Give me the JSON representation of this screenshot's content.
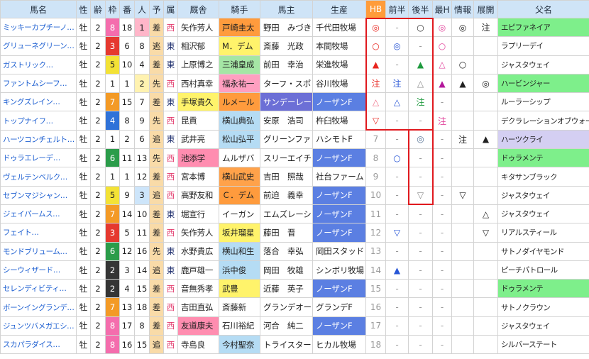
{
  "header": {
    "horse": "馬名",
    "sex": "性",
    "age": "齢",
    "waku": "枠",
    "number": "番",
    "popularity": "人",
    "style": "予",
    "affiliation": "属",
    "trainer": "厩舎",
    "jockey": "騎手",
    "owner": "馬主",
    "breeder": "生産",
    "hb": "HB",
    "first_half": "前半",
    "second_half": "後半",
    "max_h": "最H",
    "info": "情報",
    "pace": "展開",
    "sire": "父名"
  },
  "colors": {
    "header_bg": "#cfe4f7",
    "hb_header_bg": "#ff9c3a",
    "hb_header_text": "#ffffff",
    "horse_link": "#1d5fd1",
    "highlight_box": "#e0191e",
    "style_bg": "#f9dba8",
    "waku_bg": {
      "1": "#ffffff",
      "2": "#353535",
      "3": "#e5392f",
      "4": "#2f72d8",
      "5": "#f3e236",
      "6": "#2b9c4a",
      "7": "#f39a26",
      "8": "#f46dad"
    },
    "waku_text": {
      "1": "#222222",
      "2": "#ffffff",
      "3": "#ffffff",
      "4": "#ffffff",
      "5": "#222222",
      "6": "#ffffff",
      "7": "#ffffff",
      "8": "#ffffff"
    },
    "popularity_bg": {
      "1": "#ffb6c9",
      "2": "#fff2b0",
      "3": "#cde5fa"
    },
    "affiliation_text": {
      "西": "#e23a6c",
      "東": "#1f2f6e"
    },
    "mark_text": {
      "hb": "#e8261f",
      "first_half": "#2856d6",
      "second_half": "#8a8a8a",
      "max_h": "#e2459c",
      "info": "#222222",
      "pace": "#222222"
    },
    "rank_text": "#9a9a9a",
    "dash_text": "#9a9a9a"
  },
  "rows": [
    {
      "horse": "ミッキーカプチーノ…",
      "sex": "牡",
      "age": "2",
      "waku": "8",
      "number": "18",
      "popularity": "1",
      "style": "差",
      "affiliation": "西",
      "trainer": "矢作芳人",
      "jockey": "戸崎圭太",
      "owner": "野田　みづき",
      "breeder": "千代田牧場",
      "hb": "◎",
      "first_half": "-",
      "second_half": "○",
      "max_h": "◎",
      "info": "◎",
      "pace": "注",
      "sire": "エピファネイア",
      "bg": {
        "jockey": "#ff9b3d",
        "sire": "#7eef8b"
      },
      "fg": {
        "second_half": "#333333"
      }
    },
    {
      "horse": "グリューネグリーン…",
      "sex": "牡",
      "age": "2",
      "waku": "3",
      "number": "6",
      "popularity": "8",
      "style": "逃",
      "affiliation": "東",
      "trainer": "相沢郁",
      "jockey": "M．デム",
      "owner": "斎藤　光政",
      "breeder": "本間牧場",
      "hb": "○",
      "first_half": "◎",
      "second_half": "-",
      "max_h": "○",
      "info": "",
      "pace": "",
      "sire": "ラプリーデイ",
      "bg": {
        "jockey": "#fff36b"
      },
      "fg": {}
    },
    {
      "horse": "ガストリック…",
      "sex": "牡",
      "age": "2",
      "waku": "5",
      "number": "10",
      "popularity": "4",
      "style": "差",
      "affiliation": "東",
      "trainer": "上原博之",
      "jockey": "三浦皇成",
      "owner": "前田　幸治",
      "breeder": "栄進牧場",
      "hb": "▲",
      "first_half": "-",
      "second_half": "▲",
      "max_h": "△",
      "info": "○",
      "pace": "",
      "sire": "ジャスタウェイ",
      "bg": {
        "jockey": "#a5e6a5"
      },
      "fg": {
        "second_half": "#1e9a3e"
      }
    },
    {
      "horse": "ファントムシーフ…",
      "sex": "牡",
      "age": "2",
      "waku": "1",
      "number": "1",
      "popularity": "2",
      "style": "先",
      "affiliation": "西",
      "trainer": "西村真幸",
      "jockey": "福永祐一",
      "owner": "ターフ・スポ",
      "breeder": "谷川牧場",
      "hb": "注",
      "first_half": "注",
      "second_half": "△",
      "max_h": "▲",
      "info": "▲",
      "pace": "◎",
      "sire": "ハービンジャー",
      "bg": {
        "jockey": "#ff9fc0",
        "sire": "#7eef8b"
      },
      "fg": {
        "max_h": "#b3179b"
      }
    },
    {
      "horse": "キングズレイン…",
      "sex": "牡",
      "age": "2",
      "waku": "7",
      "number": "15",
      "popularity": "7",
      "style": "差",
      "affiliation": "東",
      "trainer": "手塚貴久",
      "jockey": "ルメール",
      "owner": "サンデーレー",
      "breeder": "ノーザンF",
      "hb": "△",
      "first_half": "△",
      "second_half": "注",
      "max_h": "-",
      "info": "",
      "pace": "",
      "sire": "ルーラーシップ",
      "bg": {
        "trainer": "#fff36b",
        "jockey": "#ff9b3d",
        "owner": "#6c6fd6",
        "breeder": "#5b7fe2"
      },
      "fg": {
        "owner": "#ffffff",
        "breeder": "#ffffff",
        "second_half": "#1e9a3e",
        "hb": "#ef6d86"
      }
    },
    {
      "horse": "トップナイフ…",
      "sex": "牡",
      "age": "2",
      "waku": "4",
      "number": "8",
      "popularity": "9",
      "style": "先",
      "affiliation": "西",
      "trainer": "昆貢",
      "jockey": "横山典弘",
      "owner": "安原　浩司",
      "breeder": "杵臼牧場",
      "hb": "▽",
      "first_half": "-",
      "second_half": "-",
      "max_h": "注",
      "info": "",
      "pace": "",
      "sire": "デクラレーションオブウォー",
      "bg": {
        "jockey": "#b5dcf4"
      },
      "fg": {}
    },
    {
      "horse": "ハーツコンチェルト…",
      "sex": "牡",
      "age": "2",
      "waku": "1",
      "number": "2",
      "popularity": "6",
      "style": "追",
      "affiliation": "東",
      "trainer": "武井亮",
      "jockey": "松山弘平",
      "owner": "グリーンファ",
      "breeder": "ハシモトF",
      "hb": "7",
      "first_half": "-",
      "second_half": "◎",
      "max_h": "-",
      "info": "注",
      "pace": "▲",
      "sire": "ハーツクライ",
      "bg": {
        "jockey": "#b5dcf4",
        "sire": "#d4cff2"
      },
      "fg": {
        "second_half": "#5b7799"
      }
    },
    {
      "horse": "ドゥラエレーデ…",
      "sex": "牡",
      "age": "2",
      "waku": "6",
      "number": "11",
      "popularity": "13",
      "style": "先",
      "affiliation": "西",
      "trainer": "池添学",
      "jockey": "ムルザバ",
      "owner": "スリーエイチ",
      "breeder": "ノーザンF",
      "hb": "8",
      "first_half": "○",
      "second_half": "-",
      "max_h": "-",
      "info": "",
      "pace": "",
      "sire": "ドゥラメンテ",
      "bg": {
        "trainer": "#ff8db0",
        "breeder": "#5b7fe2",
        "sire": "#7eef8b"
      },
      "fg": {
        "breeder": "#ffffff"
      }
    },
    {
      "horse": "ヴェルテンベルク…",
      "sex": "牡",
      "age": "2",
      "waku": "1",
      "number": "1",
      "popularity": "12",
      "style": "差",
      "affiliation": "西",
      "trainer": "宮本博",
      "jockey": "横山武史",
      "owner": "吉田　照哉",
      "breeder": "社台ファーム",
      "hb": "9",
      "first_half": "-",
      "second_half": "-",
      "max_h": "-",
      "info": "",
      "pace": "",
      "sire": "キタサンブラック",
      "bg": {
        "jockey": "#ffa24a"
      },
      "fg": {}
    },
    {
      "horse": "セブンマジシャン…",
      "sex": "牡",
      "age": "2",
      "waku": "5",
      "number": "9",
      "popularity": "3",
      "style": "追",
      "affiliation": "西",
      "trainer": "高野友和",
      "jockey": "Ｃ．デム",
      "owner": "前迫　義幸",
      "breeder": "ノーザンF",
      "hb": "10",
      "first_half": "-",
      "second_half": "▽",
      "max_h": "-",
      "info": "▽",
      "pace": "",
      "sire": "ジャスタウェイ",
      "bg": {
        "jockey": "#ff9b3d",
        "breeder": "#5b7fe2"
      },
      "fg": {
        "breeder": "#ffffff"
      }
    },
    {
      "horse": "ジェイパームス…",
      "sex": "牡",
      "age": "2",
      "waku": "7",
      "number": "14",
      "popularity": "10",
      "style": "差",
      "affiliation": "東",
      "trainer": "堀宣行",
      "jockey": "イーガン",
      "owner": "エムズレーシ",
      "breeder": "ノーザンF",
      "hb": "11",
      "first_half": "-",
      "second_half": "-",
      "max_h": "-",
      "info": "",
      "pace": "△",
      "sire": "ジャスタウェイ",
      "bg": {
        "breeder": "#5b7fe2"
      },
      "fg": {
        "breeder": "#ffffff"
      }
    },
    {
      "horse": "フェイト…",
      "sex": "牡",
      "age": "2",
      "waku": "3",
      "number": "5",
      "popularity": "11",
      "style": "差",
      "affiliation": "西",
      "trainer": "矢作芳人",
      "jockey": "坂井瑠星",
      "owner": "藤田　晋",
      "breeder": "ノーザンF",
      "hb": "12",
      "first_half": "▽",
      "second_half": "-",
      "max_h": "-",
      "info": "",
      "pace": "▽",
      "sire": "リアルスティール",
      "bg": {
        "jockey": "#fff36b",
        "breeder": "#5b7fe2"
      },
      "fg": {
        "breeder": "#ffffff"
      }
    },
    {
      "horse": "モンドブリューム…",
      "sex": "牡",
      "age": "2",
      "waku": "6",
      "number": "12",
      "popularity": "16",
      "style": "先",
      "affiliation": "東",
      "trainer": "水野貴広",
      "jockey": "横山和生",
      "owner": "落合　幸弘",
      "breeder": "岡田スタッド",
      "hb": "13",
      "first_half": "-",
      "second_half": "-",
      "max_h": "-",
      "info": "",
      "pace": "",
      "sire": "サトノダイヤモンド",
      "bg": {
        "jockey": "#b5dcf4"
      },
      "fg": {}
    },
    {
      "horse": "シーウィザード…",
      "sex": "牡",
      "age": "2",
      "waku": "2",
      "number": "3",
      "popularity": "14",
      "style": "追",
      "affiliation": "東",
      "trainer": "鹿戸雄一",
      "jockey": "浜中俊",
      "owner": "岡田　牧雄",
      "breeder": "シンボリ牧場",
      "hb": "14",
      "first_half": "▲",
      "second_half": "-",
      "max_h": "-",
      "info": "",
      "pace": "",
      "sire": "ピーチパトロール",
      "bg": {
        "jockey": "#b5dcf4"
      },
      "fg": {}
    },
    {
      "horse": "セレンディビティ…",
      "sex": "牡",
      "age": "2",
      "waku": "2",
      "number": "4",
      "popularity": "15",
      "style": "差",
      "affiliation": "西",
      "trainer": "音無秀孝",
      "jockey": "武豊",
      "owner": "近藤　英子",
      "breeder": "ノーザンF",
      "hb": "15",
      "first_half": "-",
      "second_half": "-",
      "max_h": "-",
      "info": "",
      "pace": "",
      "sire": "ドゥラメンテ",
      "bg": {
        "jockey": "#fff36b",
        "breeder": "#5b7fe2",
        "sire": "#7eef8b"
      },
      "fg": {
        "breeder": "#ffffff"
      }
    },
    {
      "horse": "ボーンイングランデ…",
      "sex": "牡",
      "age": "2",
      "waku": "7",
      "number": "13",
      "popularity": "18",
      "style": "差",
      "affiliation": "西",
      "trainer": "吉田直弘",
      "jockey": "斎藤新",
      "owner": "グランデオー",
      "breeder": "グランデF",
      "hb": "16",
      "first_half": "-",
      "second_half": "-",
      "max_h": "-",
      "info": "",
      "pace": "",
      "sire": "サトノクラウン",
      "bg": {},
      "fg": {}
    },
    {
      "horse": "ジュンツバメガエシ…",
      "sex": "牡",
      "age": "2",
      "waku": "8",
      "number": "17",
      "popularity": "8",
      "style": "差",
      "affiliation": "西",
      "trainer": "友道康夫",
      "jockey": "石川裕紀",
      "owner": "河合　純二",
      "breeder": "ノーザンF",
      "hb": "17",
      "first_half": "-",
      "second_half": "-",
      "max_h": "-",
      "info": "",
      "pace": "",
      "sire": "ジャスタウェイ",
      "bg": {
        "trainer": "#ff8db0",
        "breeder": "#5b7fe2"
      },
      "fg": {
        "breeder": "#ffffff"
      }
    },
    {
      "horse": "スカパラダイス…",
      "sex": "牡",
      "age": "2",
      "waku": "8",
      "number": "16",
      "popularity": "15",
      "style": "追",
      "affiliation": "西",
      "trainer": "寺島良",
      "jockey": "今村聖奈",
      "owner": "トライスター",
      "breeder": "ヒカル牧場",
      "hb": "18",
      "first_half": "-",
      "second_half": "-",
      "max_h": "-",
      "info": "",
      "pace": "",
      "sire": "シルバーステート",
      "bg": {
        "jockey": "#b5dcf4"
      },
      "fg": {}
    }
  ]
}
